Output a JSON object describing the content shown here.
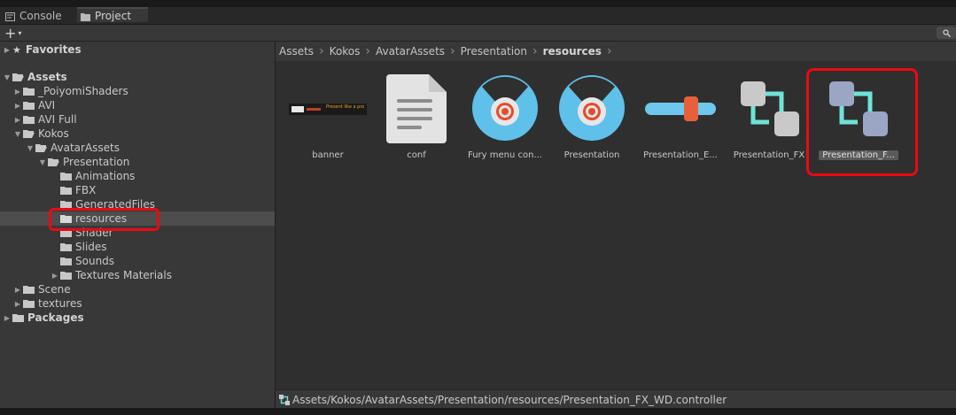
{
  "tabs": {
    "console": "Console",
    "project": "Project"
  },
  "toolbar": {
    "add_symbol": "+",
    "add_caret": "▾",
    "search_icon": "search-icon"
  },
  "tree": {
    "favorites": "Favorites",
    "assets": "Assets",
    "items": {
      "poiyomi": "_PoiyomiShaders",
      "avi": "AVI",
      "avi_full": "AVI Full",
      "kokos": "Kokos",
      "avatarassets": "AvatarAssets",
      "presentation": "Presentation",
      "animations": "Animations",
      "fbx": "FBX",
      "generatedfiles": "GeneratedFiles",
      "resources": "resources",
      "shader": "Shader",
      "slides": "Slides",
      "sounds": "Sounds",
      "textures_materials": "Textures Materials",
      "scene": "Scene",
      "textures": "textures"
    },
    "packages": "Packages"
  },
  "breadcrumb": [
    "Assets",
    "Kokos",
    "AvatarAssets",
    "Presentation",
    "resources"
  ],
  "assets": [
    {
      "label": "banner",
      "banner_text": "Present like a pro"
    },
    {
      "label": "conf"
    },
    {
      "label": "Fury menu con..."
    },
    {
      "label": "Presentation"
    },
    {
      "label": "Presentation_E..."
    },
    {
      "label": "Presentation_FX"
    },
    {
      "label": "Presentation_F..."
    }
  ],
  "status_path": "Assets/Kokos/AvatarAssets/Presentation/resources/Presentation_FX_WD.controller",
  "colors": {
    "highlight": "#ea0a12",
    "accent_cyan": "#6fe3d8",
    "avatar_blue": "#5fc0ea"
  }
}
